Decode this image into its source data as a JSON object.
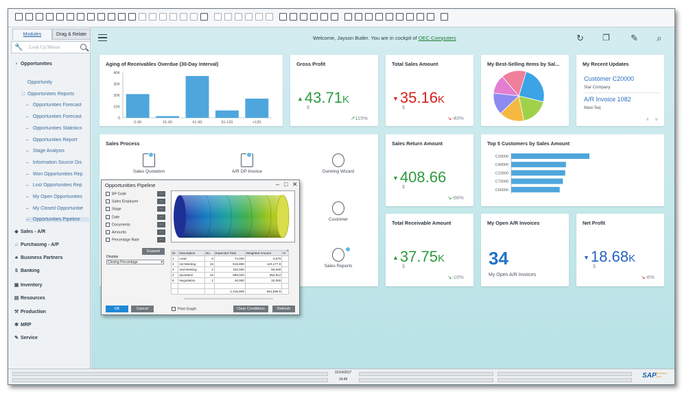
{
  "sidebar": {
    "tabs": [
      "Modules",
      "Drag & Relate"
    ],
    "search_placeholder": "Look Up Menus",
    "items": [
      {
        "label": "Opportunities",
        "level": "top",
        "icon": "person-icon"
      },
      {
        "label": "Opportunity",
        "level": "sub"
      },
      {
        "label": "Opportunities Reports",
        "level": "folder"
      },
      {
        "label": "Opportunities Forecast",
        "level": "sub2"
      },
      {
        "label": "Opportunities Forecast",
        "level": "sub2"
      },
      {
        "label": "Opportunities Statistics",
        "level": "sub2"
      },
      {
        "label": "Opportunities Report",
        "level": "sub2"
      },
      {
        "label": "Stage Analysis",
        "level": "sub2"
      },
      {
        "label": "Information Source Dis",
        "level": "sub2"
      },
      {
        "label": "Won Opportunities Rep",
        "level": "sub2"
      },
      {
        "label": "Lost Opportunities Rep",
        "level": "sub2"
      },
      {
        "label": "My Open Opportunities",
        "level": "sub2"
      },
      {
        "label": "My Closed Opportunitie",
        "level": "sub2"
      },
      {
        "label": "Opportunities Pipeline",
        "level": "sub2"
      },
      {
        "label": "Sales - A/R",
        "level": "top",
        "icon": "tag-icon"
      },
      {
        "label": "Purchasing - A/P",
        "level": "top",
        "icon": "cart-icon"
      },
      {
        "label": "Business Partners",
        "level": "top",
        "icon": "people-icon"
      },
      {
        "label": "Banking",
        "level": "top",
        "icon": "dollar-icon"
      },
      {
        "label": "Inventory",
        "level": "top",
        "icon": "box-icon"
      },
      {
        "label": "Resources",
        "level": "top",
        "icon": "factory-icon"
      },
      {
        "label": "Production",
        "level": "top",
        "icon": "production-icon"
      },
      {
        "label": "MRP",
        "level": "top",
        "icon": "gear-icon"
      },
      {
        "label": "Service",
        "level": "top",
        "icon": "service-icon"
      }
    ]
  },
  "header": {
    "welcome_prefix": "Welcome, Jayson Butler. You are in cockpit of",
    "company": "OEC Computers"
  },
  "cards": {
    "aging": {
      "title": "Aging of Receivables Overdue (30-Day Interval)",
      "chart_data": {
        "type": "bar",
        "categories": [
          "0-30",
          "31-60",
          "61-90",
          "91-120",
          ">120"
        ],
        "values": [
          21000,
          1500,
          37000,
          6500,
          17000
        ],
        "ylim": [
          0,
          40000
        ],
        "yticks": [
          "0",
          "10K",
          "20K",
          "30K",
          "40K"
        ],
        "color": "#4ea6dc"
      }
    },
    "gross_profit": {
      "title": "Gross Profit",
      "value": "43.71",
      "unit": "K",
      "currency": "$",
      "trend": "115%",
      "direction": "up"
    },
    "total_sales": {
      "title": "Total Sales Amount",
      "value": "35.16",
      "unit": "K",
      "currency": "$",
      "trend": "-40%",
      "direction": "down"
    },
    "best_selling": {
      "title": "My Best-Selling Items by Sal...",
      "chart_data": {
        "type": "pie",
        "values": [
          24,
          18,
          16,
          14,
          12,
          16
        ],
        "colors": [
          "#3ba3e6",
          "#9fd24a",
          "#f5b942",
          "#8b8bf0",
          "#e37ed0",
          "#f07f9b"
        ]
      }
    },
    "recent_updates": {
      "title": "My Recent Updates",
      "items": [
        {
          "link": "Customer C20000",
          "sub": "Star Company"
        },
        {
          "link": "A/R Invoice 1082",
          "sub": "Maxi-Teq"
        }
      ]
    },
    "sales_process": {
      "title": "Sales Process",
      "items": [
        "Sales Quotation",
        "A/R DP Invoice",
        "Dunning Wizard",
        "Customer",
        "Sales Reports"
      ]
    },
    "sales_return": {
      "title": "Sales Return Amount",
      "value": "408.66",
      "currency": "$",
      "trend": "-66%",
      "direction": "down"
    },
    "top5": {
      "title": "Top 5 Customers by Sales Amount",
      "chart_data": {
        "type": "bar",
        "orientation": "horizontal",
        "categories": [
          "C20000",
          "C40000",
          "C23900",
          "C70000",
          "C60000"
        ],
        "values": [
          100,
          70,
          69,
          66,
          62
        ]
      }
    },
    "total_receivable": {
      "title": "Total Receivable Amount",
      "value": "37.75",
      "unit": "K",
      "currency": "$",
      "trend": "-10%",
      "direction": "up"
    },
    "open_ar": {
      "title": "My Open A/R Invoices",
      "value": "34",
      "label": "My Open A/R Invoices"
    },
    "net_profit": {
      "title": "Net Profit",
      "value": "18.68",
      "unit": "K",
      "currency": "$",
      "trend": "-6%",
      "direction": "down"
    }
  },
  "dialog": {
    "title": "Opportunities Pipeline",
    "fields": [
      "BP Code",
      "Sales Employee",
      "Stage",
      "Date",
      "Documents",
      "Amounts",
      "Percentage Rate"
    ],
    "expand": "Expand",
    "display_label": "Display",
    "display_value": "Closing Percentage",
    "table": {
      "headers": [
        "ID",
        "Description",
        "No.",
        "Expected Total",
        "Weighted Amount",
        "%"
      ],
      "rows": [
        [
          "1",
          "Lead",
          "6",
          "72,000",
          "3,570",
          ""
        ],
        [
          "2",
          "1st Meeting",
          "15",
          "615,888",
          "123,177.6",
          ""
        ],
        [
          "3",
          "2nd Meeting",
          "2",
          "100,000",
          "50,000",
          ""
        ],
        [
          "4",
          "Quotation",
          "16",
          "588,020",
          "352,812",
          ""
        ],
        [
          "5",
          "Negotiation",
          "1",
          "40,000",
          "32,000",
          ""
        ]
      ],
      "totals": [
        "1,415,908",
        "561,559.6"
      ]
    },
    "ok": "OK",
    "cancel": "Cancel",
    "print_graph": "Print Graph",
    "clear": "Clear Conditions",
    "refresh": "Refresh"
  },
  "status": {
    "date": "11/14/2017",
    "time": "14:49",
    "brand": "SAP",
    "brand_sub": "Business One"
  }
}
